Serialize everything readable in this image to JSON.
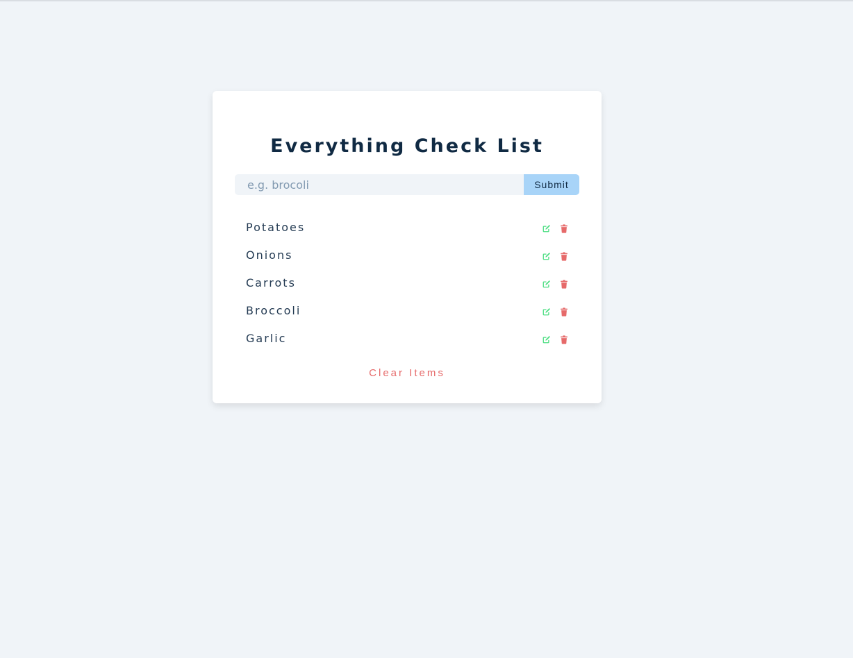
{
  "app": {
    "title": "Everything Check List"
  },
  "form": {
    "input_value": "",
    "input_placeholder": "e.g. brocoli",
    "submit_label": "Submit"
  },
  "items": [
    {
      "label": "Potatoes",
      "edit_icon": "edit-icon",
      "delete_icon": "trash-icon"
    },
    {
      "label": "Onions",
      "edit_icon": "edit-icon",
      "delete_icon": "trash-icon"
    },
    {
      "label": "Carrots",
      "edit_icon": "edit-icon",
      "delete_icon": "trash-icon"
    },
    {
      "label": "Broccoli",
      "edit_icon": "edit-icon",
      "delete_icon": "trash-icon"
    },
    {
      "label": "Garlic",
      "edit_icon": "edit-icon",
      "delete_icon": "trash-icon"
    }
  ],
  "footer": {
    "clear_label": "Clear Items"
  },
  "colors": {
    "page_background": "#f0f4f8",
    "card_background": "#ffffff",
    "title": "#102a43",
    "submit_button": "#a8d4f8",
    "edit_icon": "#4ade80",
    "delete_icon": "#e66a6a",
    "clear_text": "#e66a6a"
  }
}
